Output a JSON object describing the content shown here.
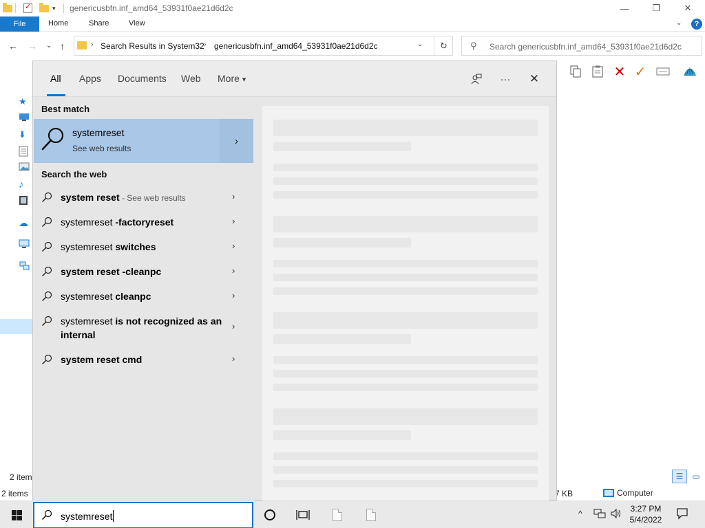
{
  "window": {
    "title": "genericusbfn.inf_amd64_53931f0ae21d6d2c",
    "minimize_icon": "—",
    "maximize_icon": "❐",
    "close_icon": "✕"
  },
  "ribbon": {
    "tabs": [
      "File",
      "Home",
      "Share",
      "View"
    ],
    "collapse_icon": "⌄",
    "help_icon": "?"
  },
  "nav": {
    "back_icon": "←",
    "forward_icon": "→",
    "recent_icon": "⌄",
    "up_icon": "↑"
  },
  "address": {
    "crumbs": [
      "Search Results in System32",
      "genericusbfn.inf_amd64_53931f0ae21d6d2c"
    ],
    "separator": "›",
    "dropdown_icon": "⌄",
    "refresh_icon": "↻"
  },
  "explorer_search": {
    "icon": "⚲",
    "text": "Search genericusbfn.inf_amd64_53931f0ae21d6d2c"
  },
  "toolbar_icons": [
    "copy-icon",
    "paste-icon",
    "delete-icon",
    "check-icon",
    "rename-icon",
    "shell-icon"
  ],
  "status": {
    "items_top": "2 item",
    "items": "2 items",
    "size": "7 KB",
    "location": "Computer"
  },
  "flyout": {
    "tabs": [
      "All",
      "Apps",
      "Documents",
      "Web",
      "More"
    ],
    "more_caret": "▾",
    "feedback_icon": "feedback-icon",
    "more_options": "···",
    "close": "✕",
    "best_match_heading": "Best match",
    "best_match": {
      "title": "systemreset",
      "subtitle": "See web results",
      "arrow": "›"
    },
    "web_heading": "Search the web",
    "suggestions": [
      {
        "prefix": "",
        "bold": "system reset",
        "suffix": " - See web results"
      },
      {
        "prefix": "systemreset ",
        "bold": "-factoryreset",
        "suffix": ""
      },
      {
        "prefix": "systemreset ",
        "bold": "switches",
        "suffix": ""
      },
      {
        "prefix": "",
        "bold": "system reset -cleanpc",
        "suffix": ""
      },
      {
        "prefix": "systemreset ",
        "bold": "cleanpc",
        "suffix": ""
      },
      {
        "prefix": "systemreset ",
        "bold": "is not recognized as an internal",
        "suffix": ""
      },
      {
        "prefix": "",
        "bold": "system reset cmd",
        "suffix": ""
      }
    ],
    "row_arrow": "›"
  },
  "taskbar": {
    "search_text": "systemreset",
    "time": "3:27 PM",
    "date": "5/4/2022",
    "tray_chevron": "^"
  },
  "colors": {
    "accent": "#1a73c6",
    "best_match_bg": "#a9c7e6",
    "file_tab": "#1979ca"
  }
}
